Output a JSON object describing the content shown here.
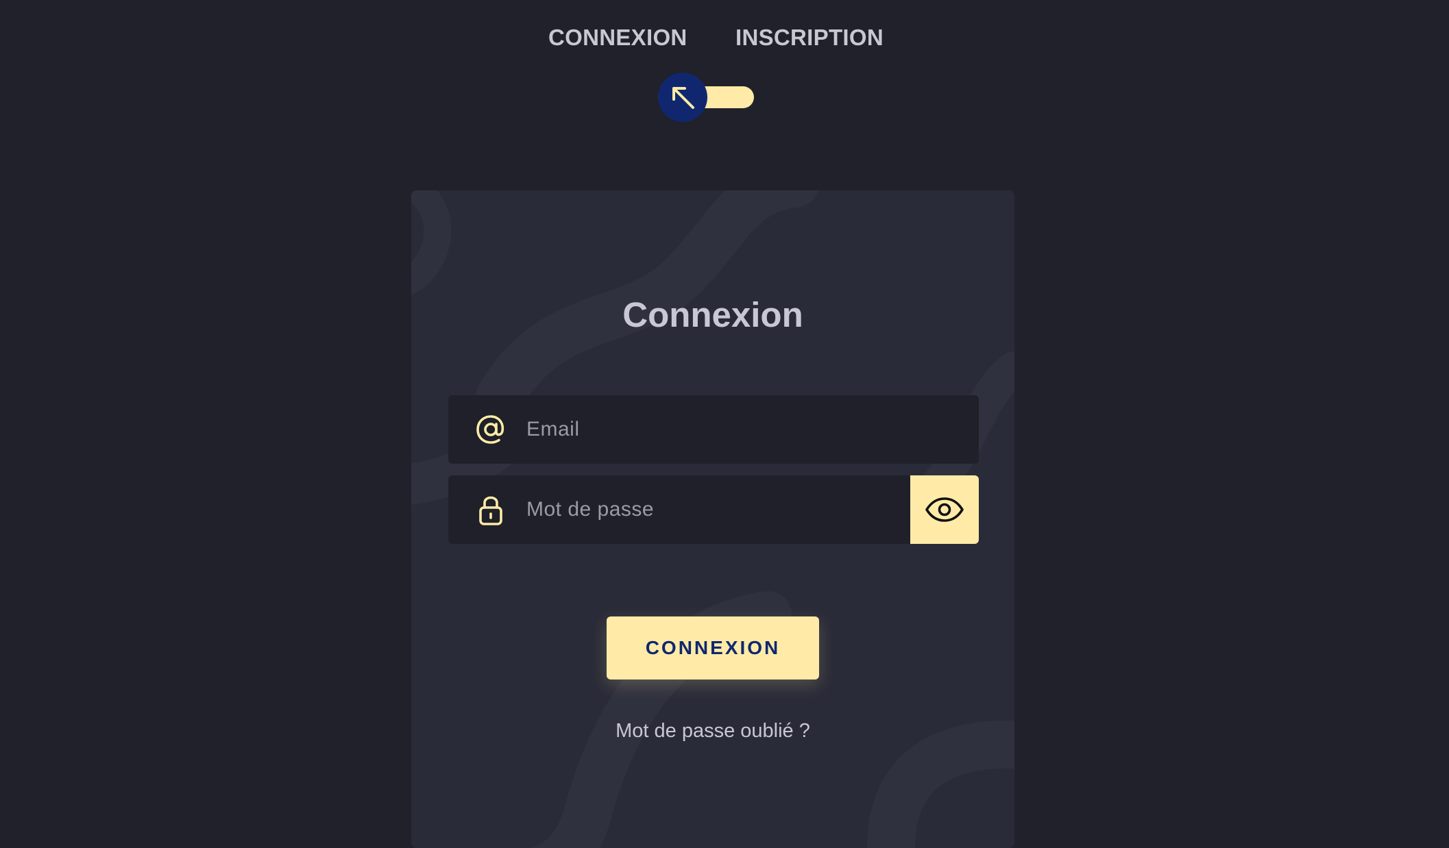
{
  "switch": {
    "login_label": "CONNEXION",
    "signup_label": "INSCRIPTION",
    "knob_icon": "arrow-up-left-icon",
    "checked": false
  },
  "card": {
    "title": "Connexion",
    "email": {
      "icon": "at-sign-icon",
      "placeholder": "Email",
      "value": ""
    },
    "password": {
      "icon": "lock-icon",
      "placeholder": "Mot de passe",
      "value": "",
      "toggle_icon": "eye-icon"
    },
    "submit_label": "CONNEXION",
    "forgot_link": "Mot de passe oublié ?"
  },
  "colors": {
    "background": "#20212a",
    "card": "#2a2b38",
    "field": "#1f2029",
    "accent": "#ffeba7",
    "knob": "#102770",
    "text": "#c7c8d3",
    "placeholder": "#9a9ba6"
  }
}
